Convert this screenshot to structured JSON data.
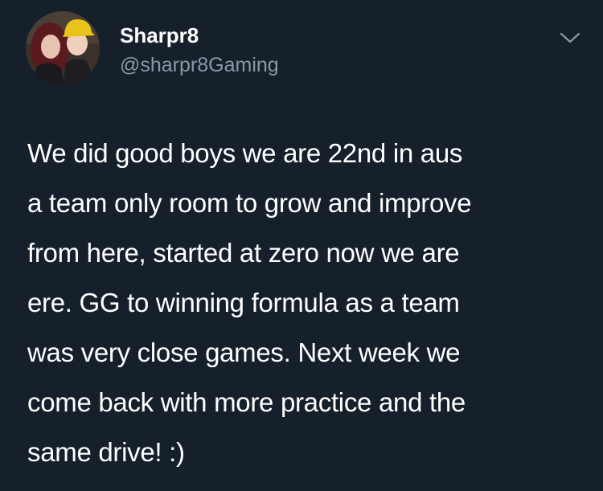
{
  "colors": {
    "background": "#15202b",
    "text_primary": "#ffffff",
    "text_secondary": "#8899a6"
  },
  "author": {
    "display_name": "Sharpr8",
    "handle": "@sharpr8Gaming",
    "avatar_icon": "profile-photo-avatar"
  },
  "menu_icon": "chevron-down-icon",
  "tweet": {
    "lines": [
      "We did good boys we are 22nd in aus",
      "a team only room to grow and improve",
      "from here, started at zero now we are",
      "ere. GG to winning formula as a team",
      "was very close games. Next week we",
      "come back with more practice and the",
      "same drive! :)"
    ]
  }
}
